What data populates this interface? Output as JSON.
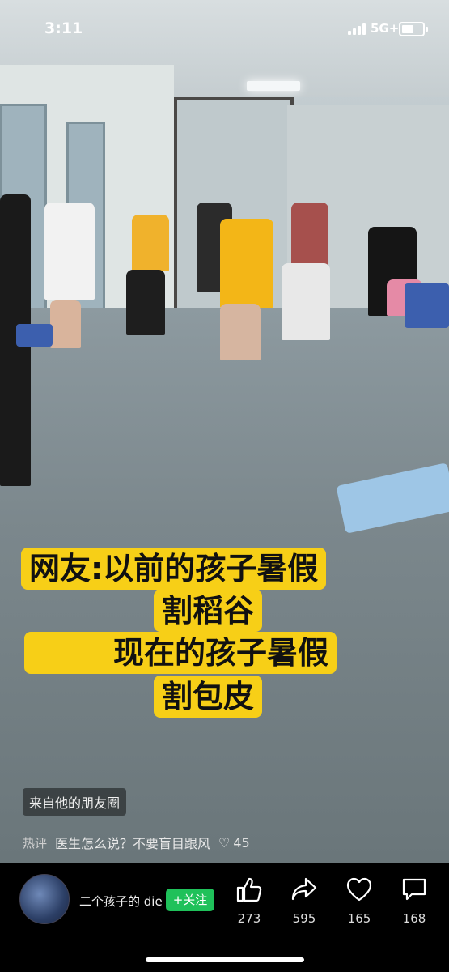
{
  "status_bar": {
    "time": "3:11",
    "network": "5G+"
  },
  "video": {
    "caption_lines": [
      "网友:以前的孩子暑假",
      "割稻谷",
      "现在的孩子暑假",
      "割包皮"
    ],
    "caption_bg": "#f7cf17",
    "source_tag": "来自他的朋友圈"
  },
  "hot_comment": {
    "label": "热评",
    "text": "医生怎么说？不要盲目跟风",
    "likes": "45"
  },
  "author": {
    "name": "二个孩子的 die",
    "follow_label": "+关注"
  },
  "actions": [
    {
      "icon": "thumbs-up-icon",
      "count": "273"
    },
    {
      "icon": "share-icon",
      "count": "595"
    },
    {
      "icon": "heart-icon",
      "count": "165"
    },
    {
      "icon": "comment-icon",
      "count": "168"
    }
  ],
  "colors": {
    "follow_button": "#1fc15a",
    "background": "#000000"
  }
}
